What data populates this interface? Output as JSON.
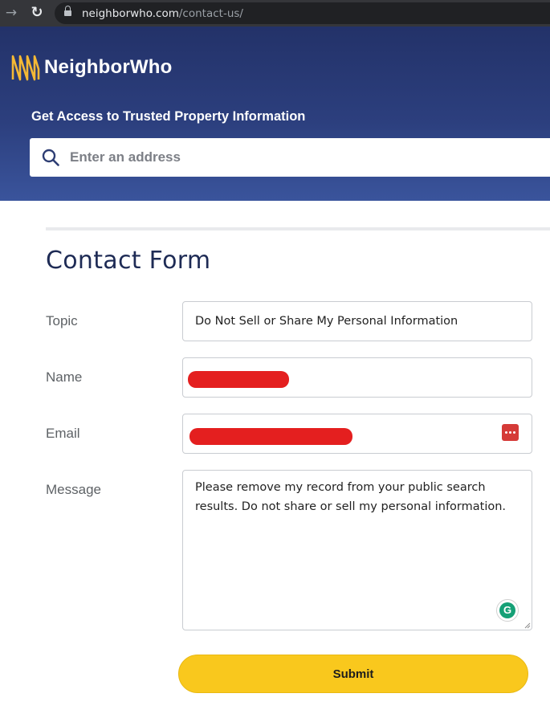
{
  "browser": {
    "url_host": "neighborwho.com",
    "url_path": "/contact-us/"
  },
  "header": {
    "brand": "NeighborWho",
    "tagline": "Get Access to Trusted Property Information",
    "search": {
      "placeholder": "Enter an address"
    }
  },
  "form": {
    "title": "Contact Form",
    "topic": {
      "label": "Topic",
      "value": "Do Not Sell or Share My Personal Information"
    },
    "name": {
      "label": "Name"
    },
    "email": {
      "label": "Email"
    },
    "message": {
      "label": "Message",
      "value": "Please remove my record from your public search results. Do not share or sell my personal information."
    },
    "submit_label": "Submit"
  },
  "colors": {
    "header_bg": "#2c3f7e",
    "accent_yellow": "#f9c81d",
    "title_navy": "#1e2b55",
    "redaction": "#e41f1f"
  },
  "icons": [
    "back-arrow-icon",
    "reload-icon",
    "lock-icon",
    "neighborwho-logo-icon",
    "search-icon",
    "password-manager-icon",
    "grammarly-icon",
    "resize-handle-icon"
  ]
}
